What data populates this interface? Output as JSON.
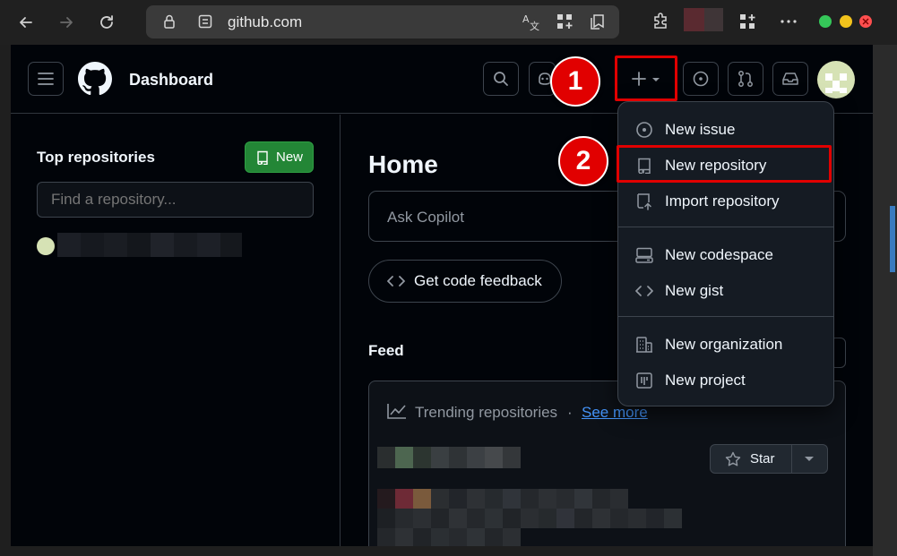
{
  "browser": {
    "url": "github.com",
    "icons": [
      "back-arrow-icon",
      "forward-arrow-icon",
      "refresh-icon",
      "lock-icon",
      "site-info-icon",
      "translate-icon",
      "apps-icon",
      "collections-icon",
      "extensions-icon",
      "add-widget-icon",
      "more-icon"
    ]
  },
  "header": {
    "title": "Dashboard",
    "icons": [
      "hamburger-icon",
      "github-logo-icon",
      "search-icon",
      "copilot-icon",
      "plus-icon",
      "issues-icon",
      "pull-requests-icon",
      "inbox-icon"
    ]
  },
  "sidebar": {
    "heading": "Top repositories",
    "new_button": "New",
    "find_placeholder": "Find a repository..."
  },
  "main": {
    "heading": "Home",
    "ask_placeholder": "Ask Copilot",
    "feedback_button": "Get code feedback",
    "feed_label": "Feed",
    "trending_label": "Trending repositories",
    "separator": "·",
    "see_more": "See more",
    "star_button": "Star"
  },
  "dropdown": {
    "items": [
      {
        "label": "New issue",
        "icon": "issue-opened-icon"
      },
      {
        "label": "New repository",
        "icon": "repo-icon"
      },
      {
        "label": "Import repository",
        "icon": "repo-push-icon"
      },
      {
        "label": "New codespace",
        "icon": "codespaces-icon"
      },
      {
        "label": "New gist",
        "icon": "code-icon"
      },
      {
        "label": "New organization",
        "icon": "organization-icon"
      },
      {
        "label": "New project",
        "icon": "project-icon"
      }
    ]
  },
  "annotations": {
    "step1": "1",
    "step2": "2",
    "color": "#e10000"
  },
  "colors": {
    "page_bg": "#010409",
    "border": "#30363d",
    "green_button": "#238636",
    "link": "#4493f8"
  }
}
